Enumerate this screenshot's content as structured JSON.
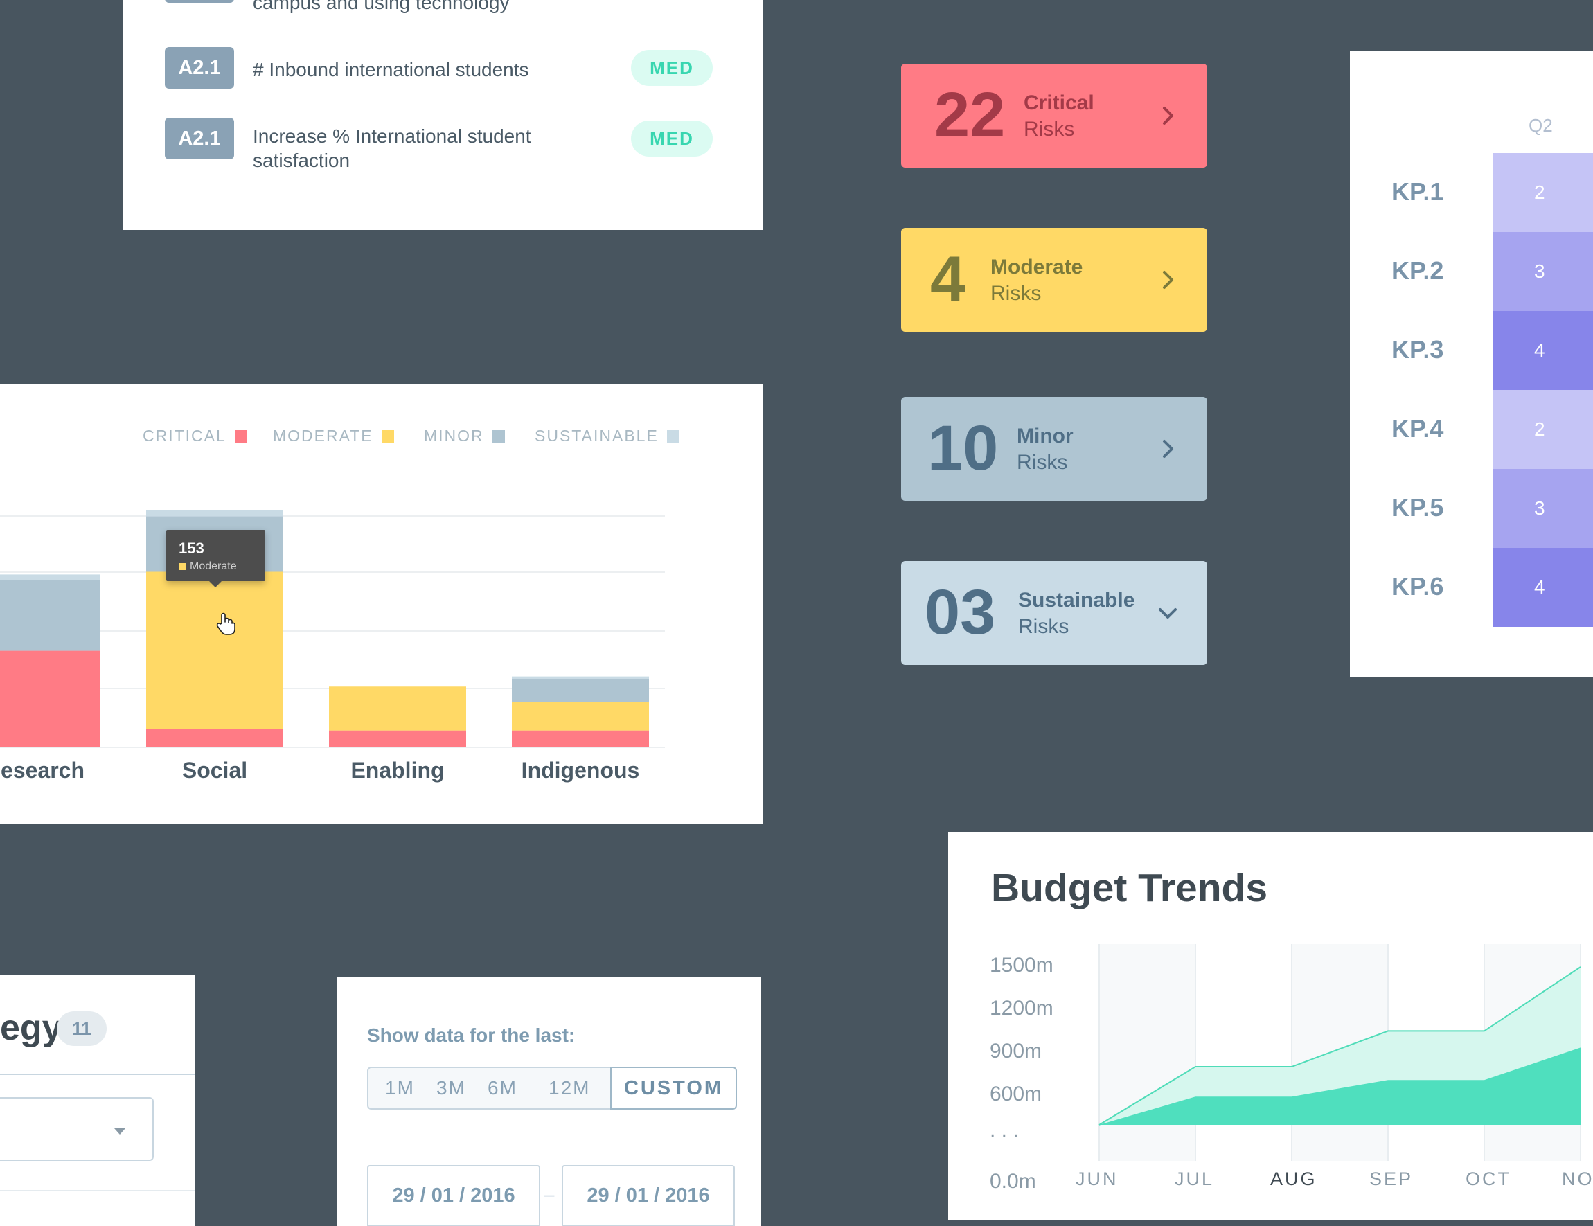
{
  "kpi_list": {
    "partial_text": "campus and using technology",
    "rows": [
      {
        "code": "A2.1",
        "text": "# Inbound international students",
        "badge": "MED"
      },
      {
        "code": "A2.1",
        "text": "Increase % International student satisfaction",
        "badge": "MED"
      }
    ]
  },
  "risk_chart": {
    "legend": [
      {
        "label": "CRITICAL",
        "color": "#ff7b85"
      },
      {
        "label": "MODERATE",
        "color": "#ffd966"
      },
      {
        "label": "MINOR",
        "color": "#aec4d1"
      },
      {
        "label": "SUSTAINABLE",
        "color": "#c9dbe5"
      }
    ],
    "tooltip": {
      "value": "153",
      "label": "Moderate"
    }
  },
  "chart_data": {
    "type": "bar",
    "stacked": true,
    "categories": [
      "Research",
      "Social",
      "Enabling",
      "Indigenous"
    ],
    "category_labels": [
      "esearch",
      "Social",
      "Enabling",
      "Indigenous"
    ],
    "series": [
      {
        "name": "CRITICAL",
        "values": [
          143,
          27,
          25,
          25
        ]
      },
      {
        "name": "MODERATE",
        "values": [
          0,
          233,
          65,
          42
        ]
      },
      {
        "name": "MINOR",
        "values": [
          105,
          82,
          0,
          34
        ]
      },
      {
        "name": "SUSTAINABLE",
        "values": [
          8,
          9,
          0,
          4
        ]
      }
    ],
    "ylim": [
      0,
      350
    ],
    "grid": true,
    "legend_position": "top"
  },
  "risks": [
    {
      "count": "22",
      "label": "Critical",
      "sub": "Risks",
      "bg": "#ff7b85",
      "fg": "#a33a48",
      "arrow": "chevron-right"
    },
    {
      "count": "4",
      "label": "Moderate",
      "sub": "Risks",
      "bg": "#ffd966",
      "fg": "#7c7a3a",
      "arrow": "chevron-right"
    },
    {
      "count": "10",
      "label": "Minor",
      "sub": "Risks",
      "bg": "#afc5d2",
      "fg": "#4f6e86",
      "arrow": "chevron-right"
    },
    {
      "count": "03",
      "label": "Sustainable",
      "sub": "Risks",
      "bg": "#c9dbe6",
      "fg": "#4f6e86",
      "arrow": "chevron-down"
    }
  ],
  "kp_heatmap": {
    "column": "Q2",
    "rows": [
      {
        "label": "KP.1",
        "value": "2",
        "color": "#c5c4f6"
      },
      {
        "label": "KP.2",
        "value": "3",
        "color": "#a6a4f0"
      },
      {
        "label": "KP.3",
        "value": "4",
        "color": "#8785ea"
      },
      {
        "label": "KP.4",
        "value": "2",
        "color": "#c5c4f6"
      },
      {
        "label": "KP.5",
        "value": "3",
        "color": "#a6a4f0"
      },
      {
        "label": "KP.6",
        "value": "4",
        "color": "#8785ea"
      }
    ]
  },
  "budget": {
    "title": "Budget Trends",
    "y_ticks": [
      "1500m",
      "1200m",
      "900m",
      "600m",
      ". . .",
      "0.0m"
    ],
    "x_ticks": [
      "JUN",
      "JUL",
      "AUG",
      "SEP",
      "OCT",
      "NOV"
    ],
    "highlight_month": "AUG",
    "upper_series": [
      0,
      700,
      700,
      1130,
      1130,
      1900
    ],
    "lower_series": [
      0,
      340,
      340,
      540,
      540,
      930
    ]
  },
  "strategy": {
    "title": "egy",
    "count": "11"
  },
  "date_range": {
    "label": "Show data for the last:",
    "options": [
      "1M",
      "3M",
      "6M",
      "12M",
      "CUSTOM"
    ],
    "selected": "CUSTOM",
    "from": "29 / 01 / 2016",
    "separator": "–",
    "to": "29 / 01 / 2016"
  }
}
